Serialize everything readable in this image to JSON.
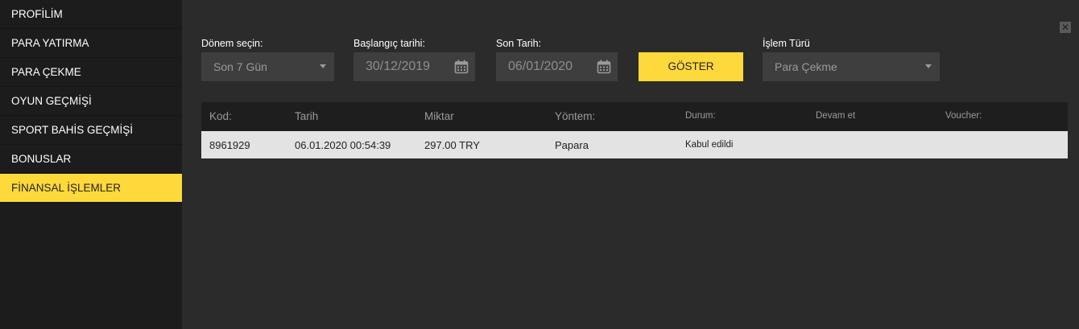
{
  "sidebar": {
    "items": [
      {
        "label": "PROFİLİM"
      },
      {
        "label": "PARA YATIRMA"
      },
      {
        "label": "PARA ÇEKME"
      },
      {
        "label": "OYUN GEÇMİŞİ"
      },
      {
        "label": "SPORT BAHİS GEÇMİŞİ"
      },
      {
        "label": "BONUSLAR"
      },
      {
        "label": "FİNANSAL İŞLEMLER",
        "active": true
      }
    ]
  },
  "close_icon": "close-icon",
  "filters": {
    "period": {
      "label": "Dönem seçin:",
      "value": "Son 7 Gün"
    },
    "start_date": {
      "label": "Başlangıç tarihi:",
      "value": "30/12/2019"
    },
    "end_date": {
      "label": "Son Tarih:",
      "value": "06/01/2020"
    },
    "show_button": "GÖSTER",
    "transaction_type": {
      "label": "İşlem Türü",
      "value": "Para Çekme"
    }
  },
  "table": {
    "headers": [
      "Kod:",
      "Tarih",
      "Miktar",
      "Yöntem:",
      "Durum:",
      "Devam et",
      "Voucher:"
    ],
    "rows": [
      [
        "8961929",
        "06.01.2020 00:54:39",
        "297.00 TRY",
        "Papara",
        "Kabul edildi",
        "",
        ""
      ]
    ]
  },
  "colors": {
    "accent": "#fed93c",
    "sidebar_bg": "#1c1c1c",
    "main_bg": "#2b2b2b",
    "input_bg": "#3e3e3e",
    "table_header_bg": "#1e1e1e",
    "table_row_bg": "#e3e3e3"
  }
}
